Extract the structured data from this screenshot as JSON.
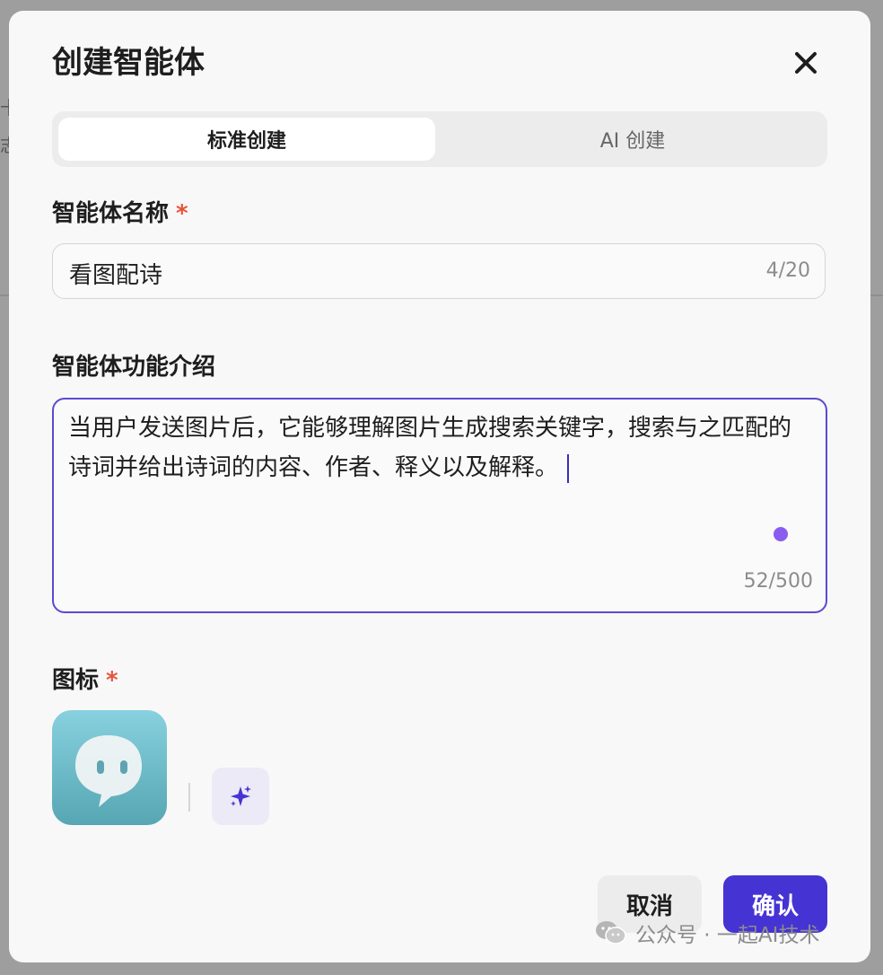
{
  "dialog": {
    "title": "创建智能体",
    "close_icon": "close-icon"
  },
  "tabs": [
    {
      "label": "标准创建",
      "active": true
    },
    {
      "label": "AI 创建",
      "active": false
    }
  ],
  "name_field": {
    "label": "智能体名称",
    "required_mark": "*",
    "value": "看图配诗",
    "counter": "4/20"
  },
  "description_field": {
    "label": "智能体功能介绍",
    "value": "当用户发送图片后，它能够理解图片生成搜索关键字，搜索与之匹配的诗词并给出诗词的内容、作者、释义以及解释。",
    "counter": "52/500",
    "focused": true
  },
  "icon_field": {
    "label": "图标",
    "required_mark": "*",
    "selected_icon": "chat-bubble-face-icon",
    "generate_icon": "sparkle-icon"
  },
  "actions": {
    "cancel_label": "取消",
    "confirm_label": "确认"
  },
  "watermark": {
    "text": "公众号 · 一起AI技术",
    "icon": "wechat-icon"
  },
  "colors": {
    "accent": "#4633d4",
    "focus_border": "#5a4bd0",
    "required": "#e8533a",
    "icon_gradient_top": "#88d1df",
    "icon_gradient_bottom": "#56a6b3"
  }
}
